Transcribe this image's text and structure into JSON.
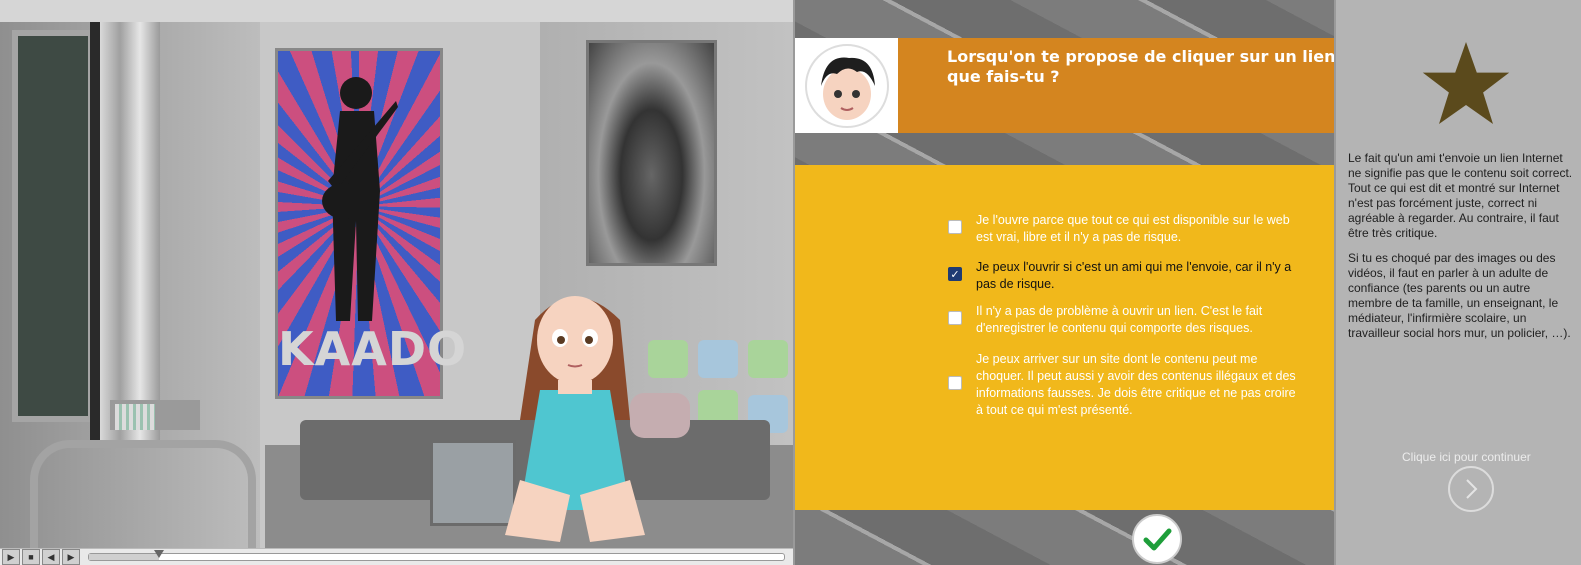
{
  "scene": {
    "poster_text": "KAADO"
  },
  "player": {
    "progress": 0.1,
    "buttons": [
      "play",
      "stop",
      "rewind",
      "forward"
    ]
  },
  "quiz": {
    "question_line1": "Lorsqu'on te propose de cliquer sur un lien in",
    "question_line2": "que fais-tu ?",
    "options": [
      {
        "text": "Je l'ouvre parce que tout ce qui est disponible sur le web est vrai, libre et il n'y a pas de risque.",
        "checked": false
      },
      {
        "text": "Je peux l'ouvrir si c'est un ami qui me l'envoie, car il n'y a pas de risque.",
        "checked": true
      },
      {
        "text": "Il n'y a pas de problème à ouvrir un lien. C'est le fait d'enregistrer le contenu qui comporte des risques.",
        "checked": false
      },
      {
        "text": "Je peux arriver sur un site dont le contenu peut me choquer. Il peut aussi y avoir des contenus illégaux et des informations fausses. Je dois être critique et ne pas croire à tout ce qui m'est présenté.",
        "checked": false
      }
    ],
    "colors": {
      "header": "#d4851f",
      "answers_bg": "#f1b81b",
      "check": "#1e9e3a"
    }
  },
  "feedback": {
    "paragraph1": "Le fait qu'un ami t'envoie un lien Internet ne signifie pas que le contenu soit correct. Tout ce qui est dit et montré sur Internet n'est pas forcément juste, correct ni agréable à regarder. Au contraire, il faut être très critique.",
    "paragraph2": "Si tu es choqué par des  images ou des vidéos, il faut en parler à un adulte de confiance (tes parents ou un autre membre de ta famille, un enseignant, le  médiateur, l'infirmière scolaire, un travailleur social hors mur, un policier, …).",
    "continue_label": "Clique ici pour continuer",
    "star_color": "#5b4a1c"
  }
}
